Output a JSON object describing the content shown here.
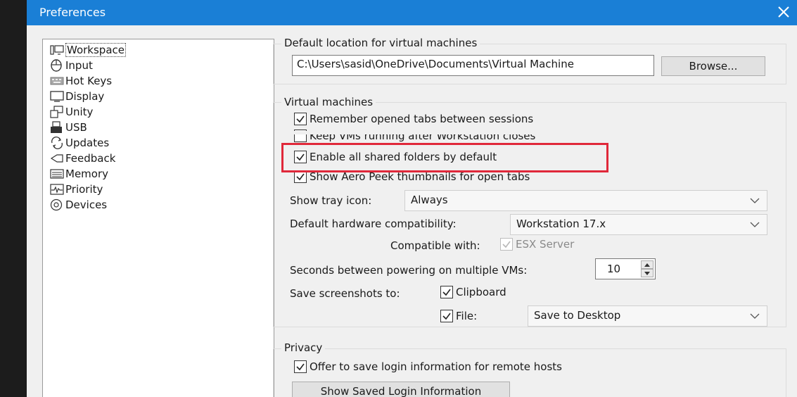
{
  "window": {
    "title": "Preferences"
  },
  "nav": {
    "items": [
      {
        "label": "Workspace",
        "icon": "workspace-icon"
      },
      {
        "label": "Input",
        "icon": "input-icon"
      },
      {
        "label": "Hot Keys",
        "icon": "hot-keys-icon"
      },
      {
        "label": "Display",
        "icon": "display-icon"
      },
      {
        "label": "Unity",
        "icon": "unity-icon"
      },
      {
        "label": "USB",
        "icon": "usb-icon"
      },
      {
        "label": "Updates",
        "icon": "updates-icon"
      },
      {
        "label": "Feedback",
        "icon": "feedback-icon"
      },
      {
        "label": "Memory",
        "icon": "memory-icon"
      },
      {
        "label": "Priority",
        "icon": "priority-icon"
      },
      {
        "label": "Devices",
        "icon": "devices-icon"
      }
    ],
    "selected": "Workspace"
  },
  "default_location": {
    "title": "Default location for virtual machines",
    "path": "C:\\Users\\sasid\\OneDrive\\Documents\\Virtual Machine",
    "browse_label": "Browse..."
  },
  "virtual_machines": {
    "title": "Virtual machines",
    "remember_tabs": "Remember opened tabs between sessions",
    "keep_running": "Keep VMs running after Workstation closes",
    "enable_shared": "Enable all shared folders by default",
    "aero_peek": "Show Aero Peek thumbnails for open tabs",
    "tray_label": "Show tray icon:",
    "tray_value": "Always",
    "hw_label": "Default hardware compatibility:",
    "hw_value": "Workstation 17.x",
    "compat_label": "Compatible with:",
    "compat_value": "ESX Server",
    "seconds_label": "Seconds between powering on multiple VMs:",
    "seconds_value": "10",
    "screenshots_label": "Save screenshots to:",
    "clipboard_label": "Clipboard",
    "file_label": "File:",
    "file_value": "Save to Desktop"
  },
  "privacy": {
    "title": "Privacy",
    "offer_save": "Offer to save login information for remote hosts",
    "show_saved_label": "Show Saved Login Information"
  },
  "colors": {
    "titlebar": "#1a7fd6",
    "highlight": "#e0283a"
  }
}
